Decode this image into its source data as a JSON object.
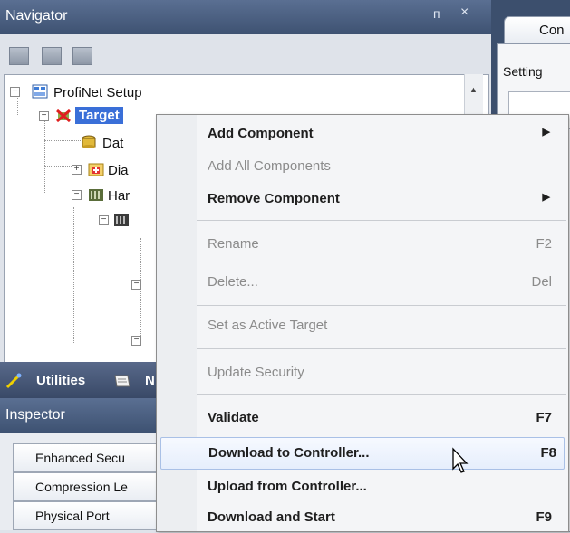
{
  "navigator": {
    "title": "Navigator",
    "pin_glyph": "ᴨ",
    "close_glyph": "×"
  },
  "tree": {
    "root_label": "ProfiNet Setup",
    "target_label": "Target",
    "data_label": "Dat",
    "diagnostics_label": "Dia",
    "hardware_label": "Har"
  },
  "doc_tab": {
    "label": "Con"
  },
  "doc_body": {
    "settings_label": "Setting"
  },
  "utilities": {
    "label": "Utilities",
    "second_tab_fragment": "N"
  },
  "inspector": {
    "title": "Inspector",
    "rows": [
      "Enhanced Secu",
      "Compression Le",
      "Physical Port"
    ]
  },
  "context_menu": {
    "add_component": "Add Component",
    "add_all_components": "Add All Components",
    "remove_component": "Remove Component",
    "rename": "Rename",
    "rename_shortcut": "F2",
    "delete": "Delete...",
    "delete_shortcut": "Del",
    "set_active_target": "Set as Active Target",
    "update_security": "Update Security",
    "validate": "Validate",
    "validate_shortcut": "F7",
    "download_to_controller": "Download to Controller...",
    "download_shortcut": "F8",
    "upload_from_controller": "Upload from Controller...",
    "download_and_start": "Download and Start",
    "download_and_start_shortcut": "F9",
    "submenu_arrow": "▶"
  },
  "colors": {
    "title_bar": "#4b5f82",
    "menu_highlight": "#e6eefc",
    "selection": "#3a6fd8"
  }
}
